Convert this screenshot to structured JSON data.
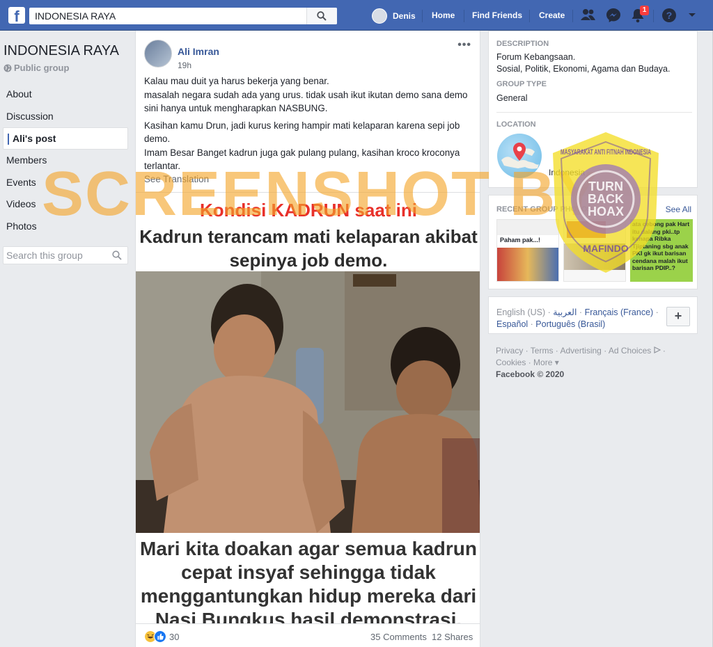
{
  "topbar": {
    "logo": "f",
    "search_value": "INDONESIA RAYA",
    "user_name": "Denis",
    "home": "Home",
    "find_friends": "Find Friends",
    "create": "Create",
    "notification_count": "1",
    "brand_color": "#4267b2"
  },
  "group": {
    "title": "INDONESIA RAYA",
    "privacy": "Public group",
    "nav": [
      "About",
      "Discussion",
      "Ali's post",
      "Members",
      "Events",
      "Videos",
      "Photos"
    ],
    "search_placeholder": "Search this group"
  },
  "post": {
    "author": "Ali Imran",
    "time": "19h",
    "paragraphs": [
      "Kalau mau duit ya harus bekerja yang benar.\nmasalah negara sudah ada yang urus. tidak usah ikut ikutan demo sana demo sini hanya untuk mengharapkan NASBUNG.",
      "Kasihan kamu Drun, jadi kurus kering hampir mati kelaparan karena sepi job demo.\nImam Besar Banget kadrun juga gak pulang pulang, kasihan kroco kroconya terlantar."
    ],
    "see_translation": "See Translation",
    "meme_title": "Kondisi KADRUN saat ini",
    "meme_subtitle": "Kadrun terancam mati kelaparan akibat sepinya job demo.",
    "meme_caption": "Mari kita doakan agar semua kadrun cepat insyaf sehingga tidak menggantungkan hidup mereka dari Nasi Bungkus hasil demonstrasi.",
    "reaction_count": "30",
    "comments": "35 Comments",
    "shares": "12 Shares"
  },
  "about": {
    "description_head": "DESCRIPTION",
    "description": "Forum Kebangsaan.\nSosial, Politik, Ekonomi, Agama dan Budaya.",
    "type_head": "GROUP TYPE",
    "type": "General",
    "location_head": "LOCATION",
    "location": "Indonesia"
  },
  "photos": {
    "head": "RECENT GROUP PHOTOS",
    "see_all": "See All",
    "thumb1_lines": [
      "Paham pak...!"
    ],
    "thumb3_lines": [
      "ata cebong pak Hart",
      "itu dalang pki..tp",
      "kenapa Ribka",
      "Tjiptaning sbg anak",
      "PKI gk ikut barisan",
      "cendana malah ikut",
      "barisan PDIP..?"
    ]
  },
  "languages": {
    "current": "English (US)",
    "arabic": "العربية",
    "french": "Français (France)",
    "spanish": "Español",
    "portuguese": "Português (Brasil)",
    "add": "+"
  },
  "footer": {
    "privacy": "Privacy",
    "terms": "Terms",
    "advertising": "Advertising",
    "ad_choices": "Ad Choices",
    "cookies": "Cookies",
    "more": "More",
    "copyright": "Facebook © 2020"
  },
  "watermark": {
    "text": "SCREENSHOT BY",
    "seal_top": "MASYARAKAT ANTI FITNAH INDONESIA",
    "seal_center": [
      "TURN",
      "BACK",
      "HOAX"
    ],
    "seal_bottom": "MAFINDO"
  }
}
